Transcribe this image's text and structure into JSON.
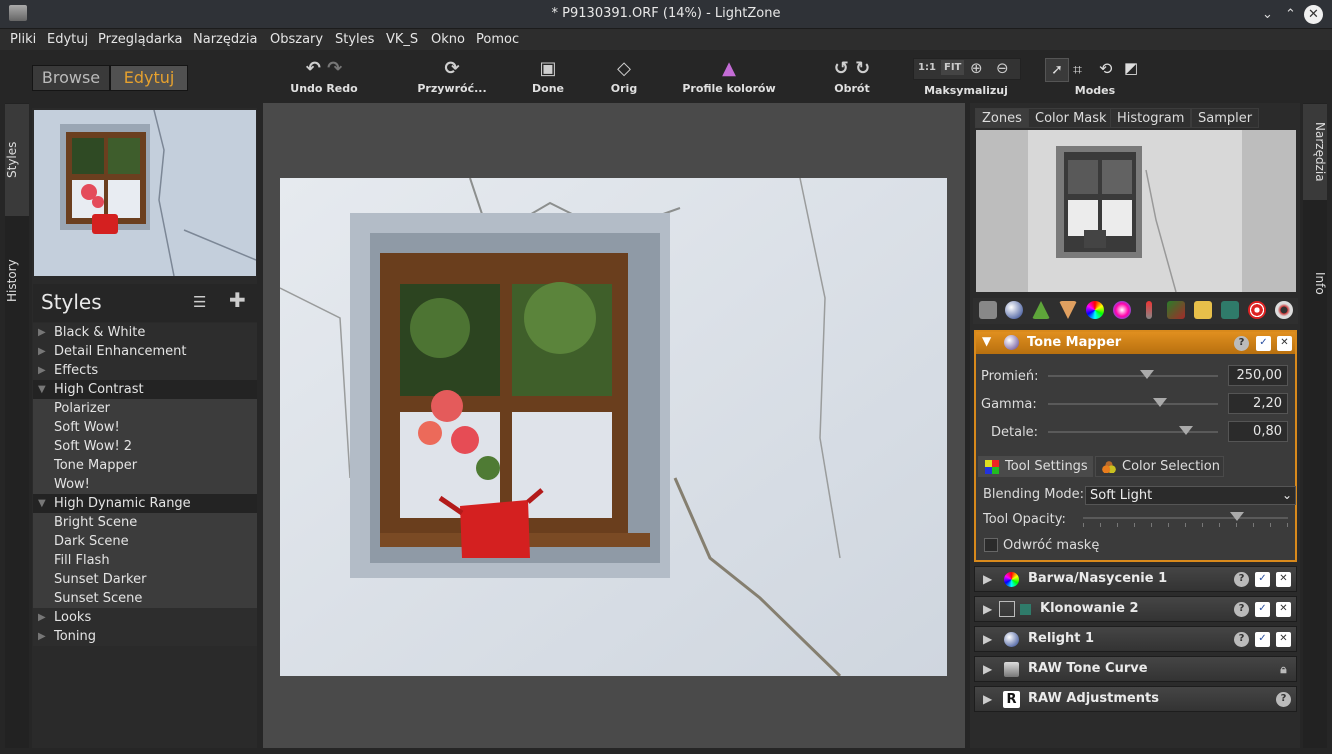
{
  "window": {
    "title": "* P9130391.ORF (14%) - LightZone"
  },
  "menu": [
    "Pliki",
    "Edytuj",
    "Przeglądarka",
    "Narzędzia",
    "Obszary",
    "Styles",
    "VK_S",
    "Okno",
    "Pomoc"
  ],
  "modes": {
    "browse": "Browse",
    "edit": "Edytuj"
  },
  "toolbar": {
    "undo_redo": "Undo Redo",
    "revert": "Przywróć...",
    "done": "Done",
    "orig": "Orig",
    "profiles": "Profile kolorów",
    "rotate": "Obrót",
    "maximize": "Maksymalizuj",
    "zoom_1_1": "1:1",
    "zoom_fit": "FIT",
    "modes": "Modes"
  },
  "left_tabs": {
    "styles": "Styles",
    "history": "History"
  },
  "styles": {
    "title": "Styles",
    "items": [
      {
        "label": "Black & White",
        "kind": "cat"
      },
      {
        "label": "Detail Enhancement",
        "kind": "cat"
      },
      {
        "label": "Effects",
        "kind": "cat"
      },
      {
        "label": "High Contrast",
        "kind": "open"
      },
      {
        "label": "Polarizer",
        "kind": "sub"
      },
      {
        "label": "Soft Wow!",
        "kind": "sub"
      },
      {
        "label": "Soft Wow! 2",
        "kind": "sub"
      },
      {
        "label": "Tone Mapper",
        "kind": "sub"
      },
      {
        "label": "Wow!",
        "kind": "sub"
      },
      {
        "label": "High Dynamic Range",
        "kind": "open"
      },
      {
        "label": "Bright Scene",
        "kind": "sub"
      },
      {
        "label": "Dark Scene",
        "kind": "sub"
      },
      {
        "label": "Fill Flash",
        "kind": "sub"
      },
      {
        "label": "Sunset Darker",
        "kind": "sub"
      },
      {
        "label": "Sunset Scene",
        "kind": "sub"
      },
      {
        "label": "Looks",
        "kind": "cat"
      },
      {
        "label": "Toning",
        "kind": "cat"
      }
    ]
  },
  "right_tabs": {
    "tools": "Narzędzia",
    "info": "Info"
  },
  "view_tabs": [
    "Zones",
    "Color Mask",
    "Histogram",
    "Sampler"
  ],
  "tone_mapper": {
    "title": "Tone Mapper",
    "sliders": [
      {
        "label": "Promień:",
        "value": "250,00",
        "level": 0.58
      },
      {
        "label": "Gamma:",
        "value": "2,20",
        "level": 0.66
      },
      {
        "label": "Detale:",
        "value": "0,80",
        "level": 0.81
      }
    ],
    "tab_settings": "Tool Settings",
    "tab_selection": "Color Selection",
    "blend_label": "Blending Mode:",
    "blend_value": "Soft Light",
    "opacity_label": "Tool Opacity:",
    "opacity_level": 0.75,
    "invert_label": "Odwróć maskę"
  },
  "tools": [
    {
      "label": "Barwa/Nasycenie 1"
    },
    {
      "label": "Klonowanie 2"
    },
    {
      "label": "Relight 1"
    },
    {
      "label": "RAW Tone Curve"
    },
    {
      "label": "RAW Adjustments"
    }
  ],
  "colors": {
    "accent": "#d98a1c",
    "edit_mode": "#e6a12e",
    "pot": "#d42020"
  }
}
